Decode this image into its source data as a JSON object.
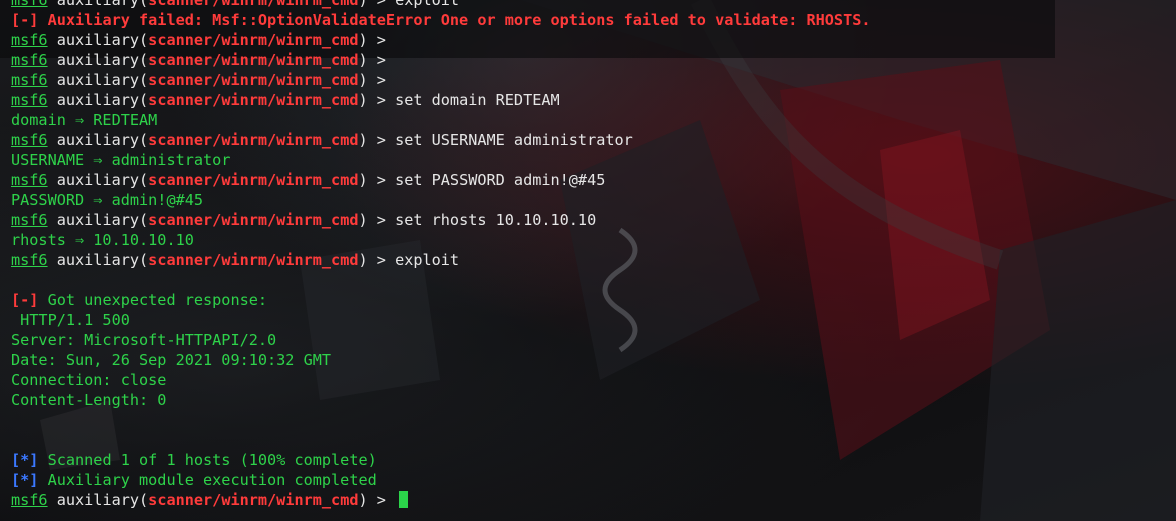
{
  "prompt": {
    "msf": "msf6",
    "aux_open": " auxiliary(",
    "module": "scanner/winrm/winrm_cmd",
    "aux_close": ") > "
  },
  "lines": [
    {
      "type": "prompt",
      "cmd": "exploit"
    },
    {
      "type": "error",
      "tag": "[-]",
      "text": " Auxiliary failed: Msf::OptionValidateError One or more options failed to validate: RHOSTS."
    },
    {
      "type": "prompt",
      "cmd": ""
    },
    {
      "type": "prompt",
      "cmd": ""
    },
    {
      "type": "prompt",
      "cmd": ""
    },
    {
      "type": "prompt",
      "cmd": "set domain REDTEAM"
    },
    {
      "type": "output",
      "text": "domain ⇒ REDTEAM"
    },
    {
      "type": "prompt",
      "cmd": "set USERNAME administrator"
    },
    {
      "type": "output",
      "text": "USERNAME ⇒ administrator"
    },
    {
      "type": "prompt",
      "cmd": "set PASSWORD admin!@#45"
    },
    {
      "type": "output",
      "text": "PASSWORD ⇒ admin!@#45"
    },
    {
      "type": "prompt",
      "cmd": "set rhosts 10.10.10.10"
    },
    {
      "type": "output",
      "text": "rhosts ⇒ 10.10.10.10"
    },
    {
      "type": "prompt",
      "cmd": "exploit"
    },
    {
      "type": "blank"
    },
    {
      "type": "error-green",
      "tag": "[-]",
      "text": " Got unexpected response:"
    },
    {
      "type": "output-green",
      "text": " HTTP/1.1 500"
    },
    {
      "type": "output-green",
      "text": "Server: Microsoft-HTTPAPI/2.0"
    },
    {
      "type": "output-green",
      "text": "Date: Sun, 26 Sep 2021 09:10:32 GMT"
    },
    {
      "type": "output-green",
      "text": "Connection: close"
    },
    {
      "type": "output-green",
      "text": "Content-Length: 0"
    },
    {
      "type": "blank"
    },
    {
      "type": "blank"
    },
    {
      "type": "info",
      "tag": "[*]",
      "text": " Scanned 1 of 1 hosts (100% complete)"
    },
    {
      "type": "info",
      "tag": "[*]",
      "text": " Auxiliary module execution completed"
    },
    {
      "type": "prompt",
      "cmd": "",
      "cursor": true
    }
  ],
  "colors": {
    "prompt_green": "#2ed24a",
    "module_red": "#ff3b3b",
    "info_blue": "#3b78ff",
    "text_white": "#e6e6e6"
  }
}
